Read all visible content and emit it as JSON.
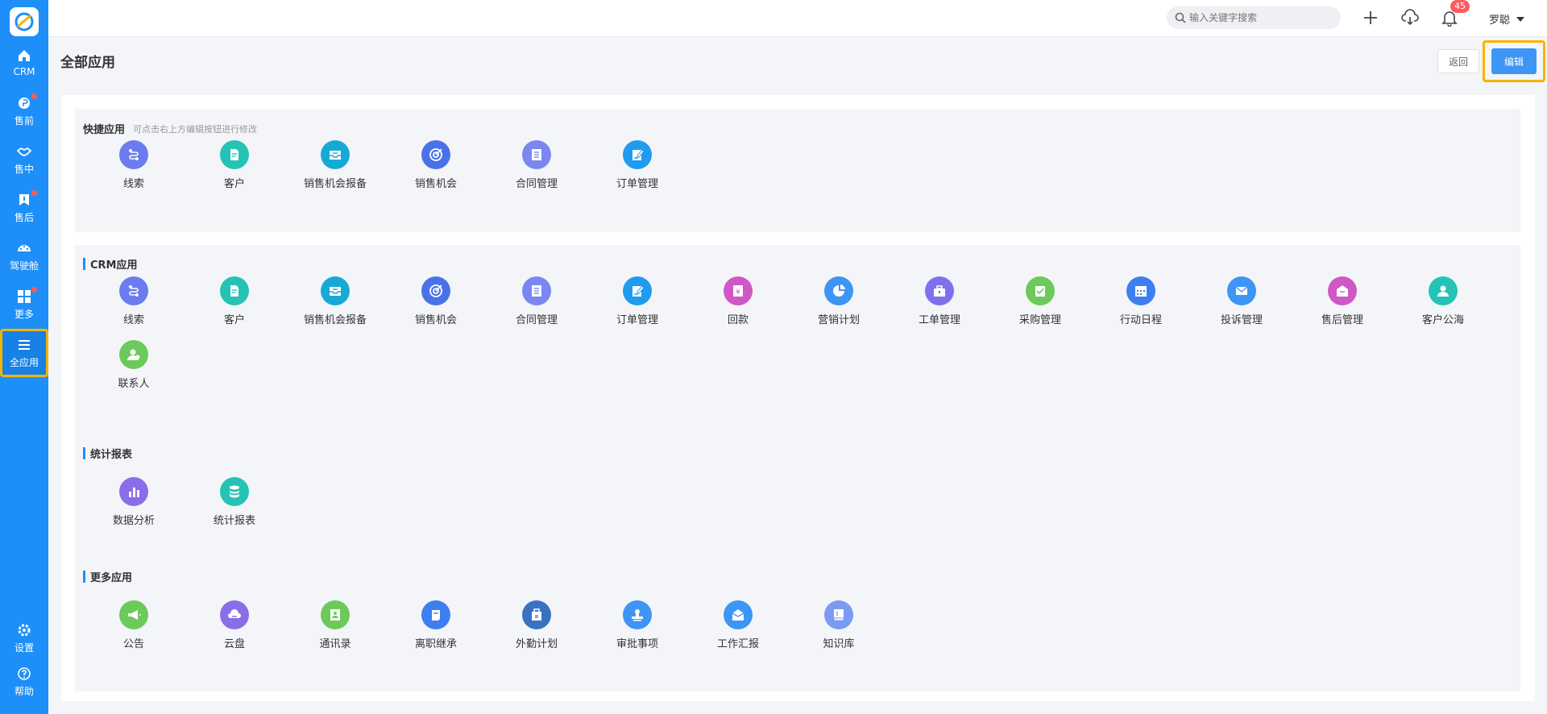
{
  "nav": [
    {
      "label": "CRM",
      "icon": "home-icon",
      "dot": false,
      "active": false
    },
    {
      "label": "售前",
      "icon": "pin-icon",
      "dot": true,
      "active": false
    },
    {
      "label": "售中",
      "icon": "handshake-icon",
      "dot": false,
      "active": false
    },
    {
      "label": "售后",
      "icon": "bookmark-icon",
      "dot": true,
      "active": false
    },
    {
      "label": "驾驶舱",
      "icon": "dashboard-icon",
      "dot": false,
      "active": false
    },
    {
      "label": "更多",
      "icon": "grid-icon",
      "dot": true,
      "active": false
    },
    {
      "label": "全应用",
      "icon": "menu-icon",
      "dot": false,
      "active": true
    }
  ],
  "nav_bottom": [
    {
      "label": "设置",
      "icon": "gear-icon"
    },
    {
      "label": "帮助",
      "icon": "help-icon"
    }
  ],
  "topbar": {
    "search_placeholder": "输入关键字搜索",
    "notification_count": "45",
    "user_name": "罗聪"
  },
  "page": {
    "title": "全部应用",
    "back_label": "返回",
    "edit_label": "编辑"
  },
  "sections": {
    "quick": {
      "title": "快捷应用",
      "hint": "可点击右上方编辑按钮进行修改",
      "apps": [
        {
          "label": "线索",
          "icon": "route-icon",
          "color": "#6c7cf0"
        },
        {
          "label": "客户",
          "icon": "document-icon",
          "color": "#24c3b5"
        },
        {
          "label": "销售机会报备",
          "icon": "inbox-icon",
          "color": "#17a9d6"
        },
        {
          "label": "销售机会",
          "icon": "target-icon",
          "color": "#4a72e8"
        },
        {
          "label": "合同管理",
          "icon": "list-doc-icon",
          "color": "#7b86f0"
        },
        {
          "label": "订单管理",
          "icon": "edit-doc-icon",
          "color": "#1f9bf0"
        }
      ]
    },
    "crm": {
      "title": "CRM应用",
      "apps": [
        {
          "label": "线索",
          "icon": "route-icon",
          "color": "#6c7cf0"
        },
        {
          "label": "客户",
          "icon": "document-icon",
          "color": "#24c3b5"
        },
        {
          "label": "销售机会报备",
          "icon": "inbox-icon",
          "color": "#17a9d6"
        },
        {
          "label": "销售机会",
          "icon": "target-icon",
          "color": "#4a72e8"
        },
        {
          "label": "合同管理",
          "icon": "list-doc-icon",
          "color": "#7b86f0"
        },
        {
          "label": "订单管理",
          "icon": "edit-doc-icon",
          "color": "#1f9bf0"
        },
        {
          "label": "回款",
          "icon": "receipt-icon",
          "color": "#d057c6"
        },
        {
          "label": "营销计划",
          "icon": "pie-icon",
          "color": "#3d95f5"
        },
        {
          "label": "工单管理",
          "icon": "briefcase-icon",
          "color": "#8070ee"
        },
        {
          "label": "采购管理",
          "icon": "purchase-icon",
          "color": "#6cc95b"
        },
        {
          "label": "行动日程",
          "icon": "calendar-icon",
          "color": "#3d7ff0"
        },
        {
          "label": "投诉管理",
          "icon": "mail-icon",
          "color": "#3d95f5"
        },
        {
          "label": "售后管理",
          "icon": "box-icon",
          "color": "#d057c6"
        },
        {
          "label": "客户公海",
          "icon": "user-icon",
          "color": "#24c3b5"
        },
        {
          "label": "联系人",
          "icon": "contact-icon",
          "color": "#6cc95b"
        }
      ]
    },
    "stats": {
      "title": "统计报表",
      "apps": [
        {
          "label": "数据分析",
          "icon": "bar-chart-icon",
          "color": "#8a6ee8"
        },
        {
          "label": "统计报表",
          "icon": "database-icon",
          "color": "#24c3b5"
        }
      ]
    },
    "more": {
      "title": "更多应用",
      "apps": [
        {
          "label": "公告",
          "icon": "megaphone-icon",
          "color": "#6cc95b"
        },
        {
          "label": "云盘",
          "icon": "cloud-drive-icon",
          "color": "#8a6ee8"
        },
        {
          "label": "通讯录",
          "icon": "address-book-icon",
          "color": "#6cc95b"
        },
        {
          "label": "离职继承",
          "icon": "scroll-icon",
          "color": "#3d7ff0"
        },
        {
          "label": "外勤计划",
          "icon": "bag-icon",
          "color": "#3a72c2"
        },
        {
          "label": "审批事项",
          "icon": "stamp-icon",
          "color": "#3d95f5"
        },
        {
          "label": "工作汇报",
          "icon": "report-icon",
          "color": "#3d95f5"
        },
        {
          "label": "知识库",
          "icon": "book-icon",
          "color": "#7b9af0"
        }
      ]
    }
  }
}
